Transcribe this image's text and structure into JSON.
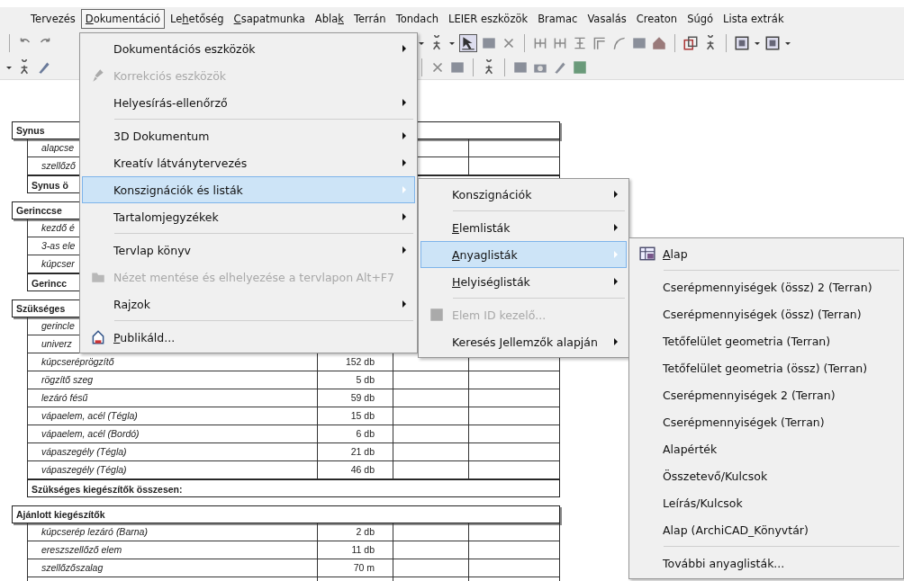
{
  "menubar": [
    {
      "label": "Tervezés",
      "selected": false
    },
    {
      "label": "Dokumentáció",
      "selected": true
    },
    {
      "label": "Lehetőség",
      "selected": false
    },
    {
      "label": "Csapatmunka",
      "selected": false
    },
    {
      "label": "Ablak",
      "selected": false
    },
    {
      "label": "Terrán",
      "selected": false
    },
    {
      "label": "Tondach",
      "selected": false
    },
    {
      "label": "LEIER eszközök",
      "selected": false
    },
    {
      "label": "Bramac",
      "selected": false
    },
    {
      "label": "Vasalás",
      "selected": false
    },
    {
      "label": "Creaton",
      "selected": false
    },
    {
      "label": "Súgó",
      "selected": false
    },
    {
      "label": "Lista extrák",
      "selected": false
    }
  ],
  "menu": [
    {
      "kind": "item",
      "label": "Dokumentációs eszközök",
      "submenu": true,
      "disabled": false,
      "selected": false
    },
    {
      "kind": "item",
      "label": "Korrekciós eszközök",
      "submenu": false,
      "disabled": true,
      "selected": false,
      "icon": true
    },
    {
      "kind": "item",
      "label": "Helyesírás-ellenőrző",
      "submenu": true,
      "disabled": false,
      "selected": false
    },
    {
      "kind": "separator"
    },
    {
      "kind": "item",
      "label": "3D Dokumentum",
      "submenu": true,
      "disabled": false,
      "selected": false
    },
    {
      "kind": "item",
      "label": "Kreatív látványtervezés",
      "submenu": true,
      "disabled": false,
      "selected": false
    },
    {
      "kind": "item",
      "label": "Konszignációk és listák",
      "submenu": true,
      "disabled": false,
      "selected": true
    },
    {
      "kind": "item",
      "label": "Tartalomjegyzékek",
      "submenu": true,
      "disabled": false,
      "selected": false
    },
    {
      "kind": "separator"
    },
    {
      "kind": "item",
      "label": "Tervlap könyv",
      "submenu": true,
      "disabled": false,
      "selected": false
    },
    {
      "kind": "item",
      "label": "Nézet mentése és elhelyezése a tervlapon",
      "submenu": false,
      "disabled": true,
      "selected": false,
      "icon": true,
      "shortcut": "Alt+F7"
    },
    {
      "kind": "item",
      "label": "Rajzok",
      "submenu": true,
      "disabled": false,
      "selected": false
    },
    {
      "kind": "separator"
    },
    {
      "kind": "item",
      "label": "Publikáld...",
      "submenu": false,
      "disabled": false,
      "selected": false,
      "icon": true
    }
  ],
  "submenu": [
    {
      "kind": "item",
      "label": "Konszignációk",
      "submenu": true,
      "disabled": false,
      "selected": false
    },
    {
      "kind": "separator"
    },
    {
      "kind": "item",
      "label": "Elemlisták",
      "submenu": true,
      "disabled": false,
      "selected": false
    },
    {
      "kind": "item",
      "label": "Anyaglisták",
      "submenu": true,
      "disabled": false,
      "selected": true
    },
    {
      "kind": "item",
      "label": "Helyiséglisták",
      "submenu": true,
      "disabled": false,
      "selected": false
    },
    {
      "kind": "separator"
    },
    {
      "kind": "item",
      "label": "Elem ID kezelő...",
      "submenu": false,
      "disabled": true,
      "selected": false,
      "icon": true
    },
    {
      "kind": "item",
      "label": "Keresés Jellemzők alapján",
      "submenu": true,
      "disabled": false,
      "selected": false
    }
  ],
  "submenu_2": [
    {
      "kind": "item",
      "label": "Alap",
      "submenu": false,
      "disabled": false,
      "selected": false,
      "icon": true
    },
    {
      "kind": "separator"
    },
    {
      "kind": "item",
      "label": "Cserépmennyiségek (össz) 2 (Terran)",
      "submenu": false,
      "disabled": false,
      "selected": false
    },
    {
      "kind": "item",
      "label": "Cserépmennyiségek (össz) (Terran)",
      "submenu": false,
      "disabled": false,
      "selected": false
    },
    {
      "kind": "item",
      "label": "Tetőfelület geometria (Terran)",
      "submenu": false,
      "disabled": false,
      "selected": false
    },
    {
      "kind": "item",
      "label": "Tetőfelület geometria (össz) (Terran)",
      "submenu": false,
      "disabled": false,
      "selected": false
    },
    {
      "kind": "item",
      "label": "Cserépmennyiségek 2 (Terran)",
      "submenu": false,
      "disabled": false,
      "selected": false
    },
    {
      "kind": "item",
      "label": "Cserépmennyiségek (Terran)",
      "submenu": false,
      "disabled": false,
      "selected": false
    },
    {
      "kind": "item",
      "label": "Alapérték",
      "submenu": false,
      "disabled": false,
      "selected": false
    },
    {
      "kind": "item",
      "label": "Összetevő/Kulcsok",
      "submenu": false,
      "disabled": false,
      "selected": false
    },
    {
      "kind": "item",
      "label": "Leírás/Kulcsok",
      "submenu": false,
      "disabled": false,
      "selected": false
    },
    {
      "kind": "item",
      "label": "Alap (ArchiCAD_Könyvtár)",
      "submenu": false,
      "disabled": false,
      "selected": false
    },
    {
      "kind": "separator"
    },
    {
      "kind": "item",
      "label": "További anyaglisták...",
      "submenu": false,
      "disabled": false,
      "selected": false
    }
  ],
  "document": {
    "sections": [
      {
        "rows": [
          {
            "kind": "header",
            "name": "Synus"
          },
          {
            "kind": "item",
            "name": "alapcse"
          },
          {
            "kind": "item",
            "name": "szellőző"
          },
          {
            "kind": "total",
            "name": "Synus ö"
          }
        ]
      },
      {
        "rows": [
          {
            "kind": "header",
            "name": "Gerinccse"
          },
          {
            "kind": "item",
            "name": "kezdő é"
          },
          {
            "kind": "item",
            "name": "3-as ele"
          },
          {
            "kind": "item",
            "name": "kúpcser"
          },
          {
            "kind": "total",
            "name": "Gerincc"
          }
        ]
      },
      {
        "rows": [
          {
            "kind": "header",
            "name": "Szükséges"
          },
          {
            "kind": "item",
            "name": "gerincle"
          },
          {
            "kind": "item",
            "name": "univerz"
          },
          {
            "kind": "item",
            "name": "kúpcseréprögzítő",
            "qty": "152 db"
          },
          {
            "kind": "item",
            "name": "rögzítő szeg",
            "qty": "5 db"
          },
          {
            "kind": "item",
            "name": "lezáró fésű",
            "qty": "59 db"
          },
          {
            "kind": "item",
            "name": "vápaelem, acél (Tégla)",
            "qty": "15 db"
          },
          {
            "kind": "item",
            "name": "vápaelem, acél (Bordó)",
            "qty": "6 db"
          },
          {
            "kind": "item",
            "name": "vápaszegély (Tégla)",
            "qty": "21 db"
          },
          {
            "kind": "item",
            "name": "vápaszegély (Tégla)",
            "qty": "46 db"
          },
          {
            "kind": "total",
            "name": "Szükséges kiegészítők összesen:"
          }
        ]
      },
      {
        "rows": [
          {
            "kind": "header",
            "name": "Ajánlott kiegészítők"
          },
          {
            "kind": "item",
            "name": "kúpcserép lezáró (Barna)",
            "qty": "2 db"
          },
          {
            "kind": "item",
            "name": "ereszszellőző elem",
            "qty": "11 db"
          },
          {
            "kind": "item",
            "name": "szellőzőszalag",
            "qty": "70 m"
          },
          {
            "kind": "item"
          }
        ]
      }
    ]
  }
}
